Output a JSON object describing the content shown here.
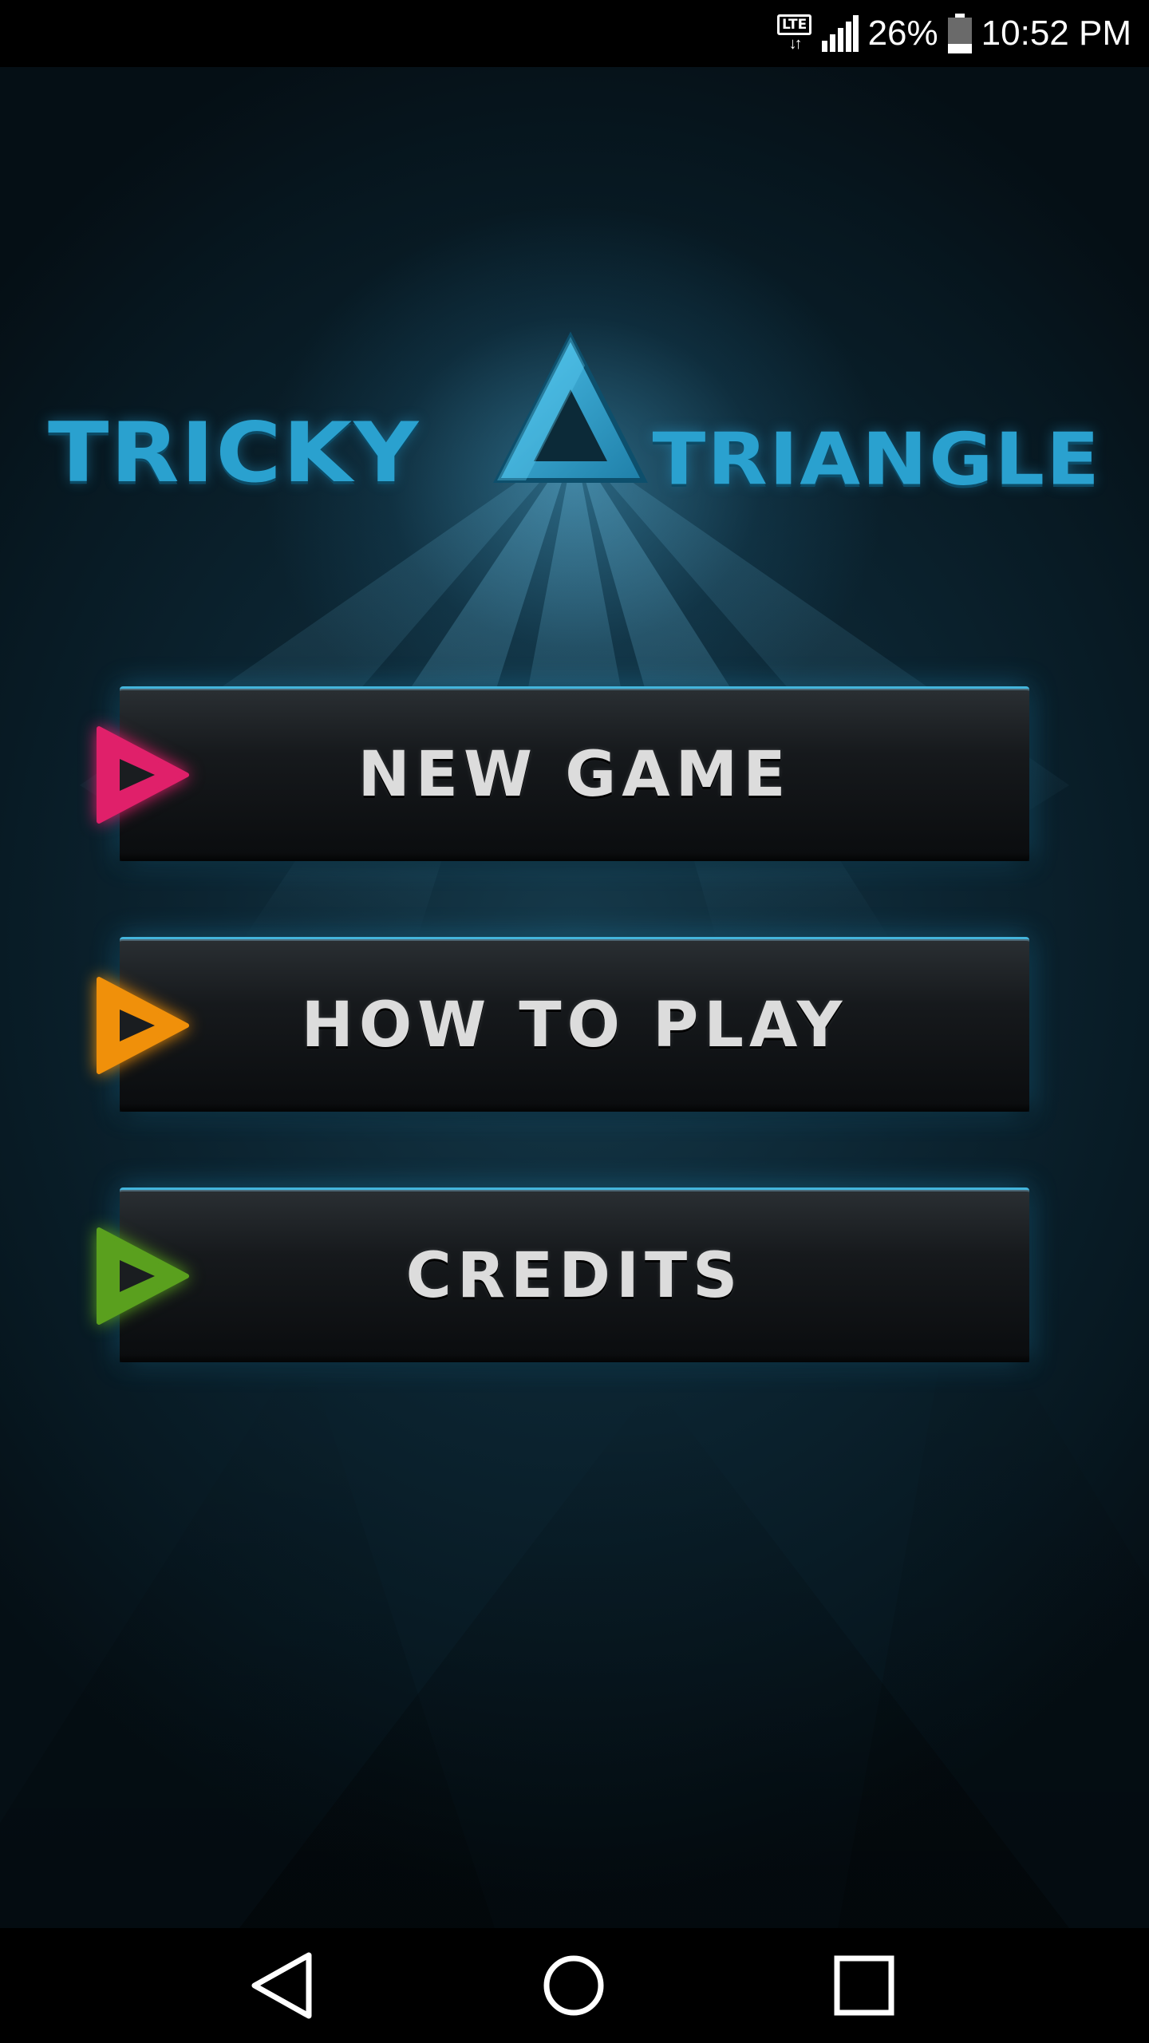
{
  "status_bar": {
    "network": "LTE",
    "battery_percent_text": "26%",
    "battery_level": 0.26,
    "time": "10:52 PM"
  },
  "logo": {
    "word_left": "TRICKY",
    "word_right": "TRIANGLE",
    "color": "#2aa1cf"
  },
  "menu": {
    "buttons": [
      {
        "label": "NEW GAME",
        "icon": "play-triangle-icon",
        "icon_color": "#e0206a"
      },
      {
        "label": "HOW TO PLAY",
        "icon": "play-triangle-icon",
        "icon_color": "#f0900a"
      },
      {
        "label": "CREDITS",
        "icon": "play-triangle-icon",
        "icon_color": "#5aa01e"
      }
    ]
  },
  "nav_bar": {
    "buttons": [
      "back-icon",
      "home-icon",
      "recents-icon"
    ]
  }
}
